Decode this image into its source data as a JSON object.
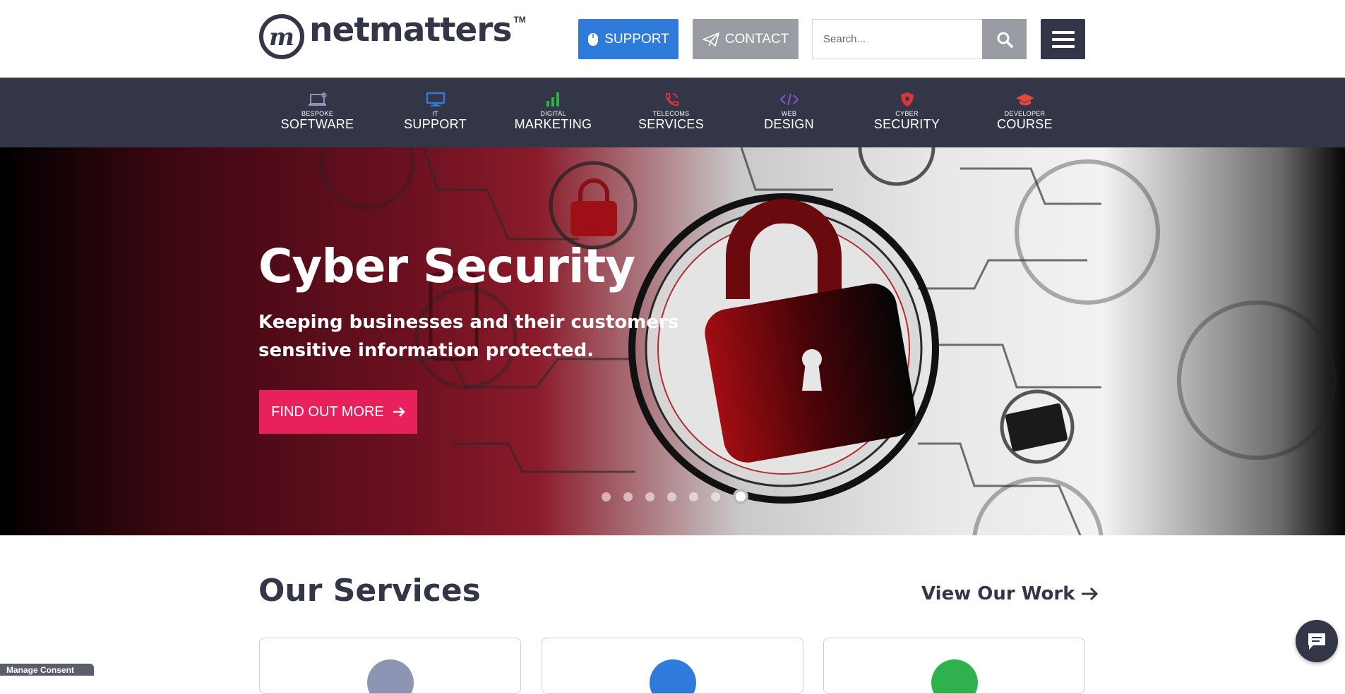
{
  "header": {
    "logo_text": "netmatters",
    "logo_tm": "TM",
    "support_label": "SUPPORT",
    "contact_label": "CONTACT",
    "search_placeholder": "Search..."
  },
  "nav": {
    "items": [
      {
        "small": "BESPOKE",
        "big": "SOFTWARE",
        "icon": "laptop-icon",
        "color": "#8e95b4"
      },
      {
        "small": "IT",
        "big": "SUPPORT",
        "icon": "monitor-icon",
        "color": "#2f7bdb"
      },
      {
        "small": "DIGITAL",
        "big": "MARKETING",
        "icon": "bar-chart-icon",
        "color": "#2fb14e"
      },
      {
        "small": "TELECOMS",
        "big": "SERVICES",
        "icon": "phone-icon",
        "color": "#d8343c"
      },
      {
        "small": "WEB",
        "big": "DESIGN",
        "icon": "code-icon",
        "color": "#8c4fc9"
      },
      {
        "small": "CYBER",
        "big": "SECURITY",
        "icon": "shield-icon",
        "color": "#d8343c"
      },
      {
        "small": "DEVELOPER",
        "big": "COURSE",
        "icon": "graduation-cap-icon",
        "color": "#e04a3c"
      }
    ]
  },
  "hero": {
    "title": "Cyber Security",
    "subtitle": "Keeping businesses and their customers sensitive information protected.",
    "cta_label": "FIND OUT MORE",
    "slide_count": 7,
    "active_slide": 7
  },
  "services": {
    "title": "Our Services",
    "view_work_label": "View Our Work",
    "card_icon_colors": [
      "#8e95b4",
      "#2f7bdb",
      "#2fb14e"
    ]
  },
  "consent_label": "Manage Consent",
  "colors": {
    "brand_dark": "#333646",
    "support_blue": "#2f7bdb",
    "contact_grey": "#9a9ca4",
    "cta_pink": "#e8215d"
  }
}
